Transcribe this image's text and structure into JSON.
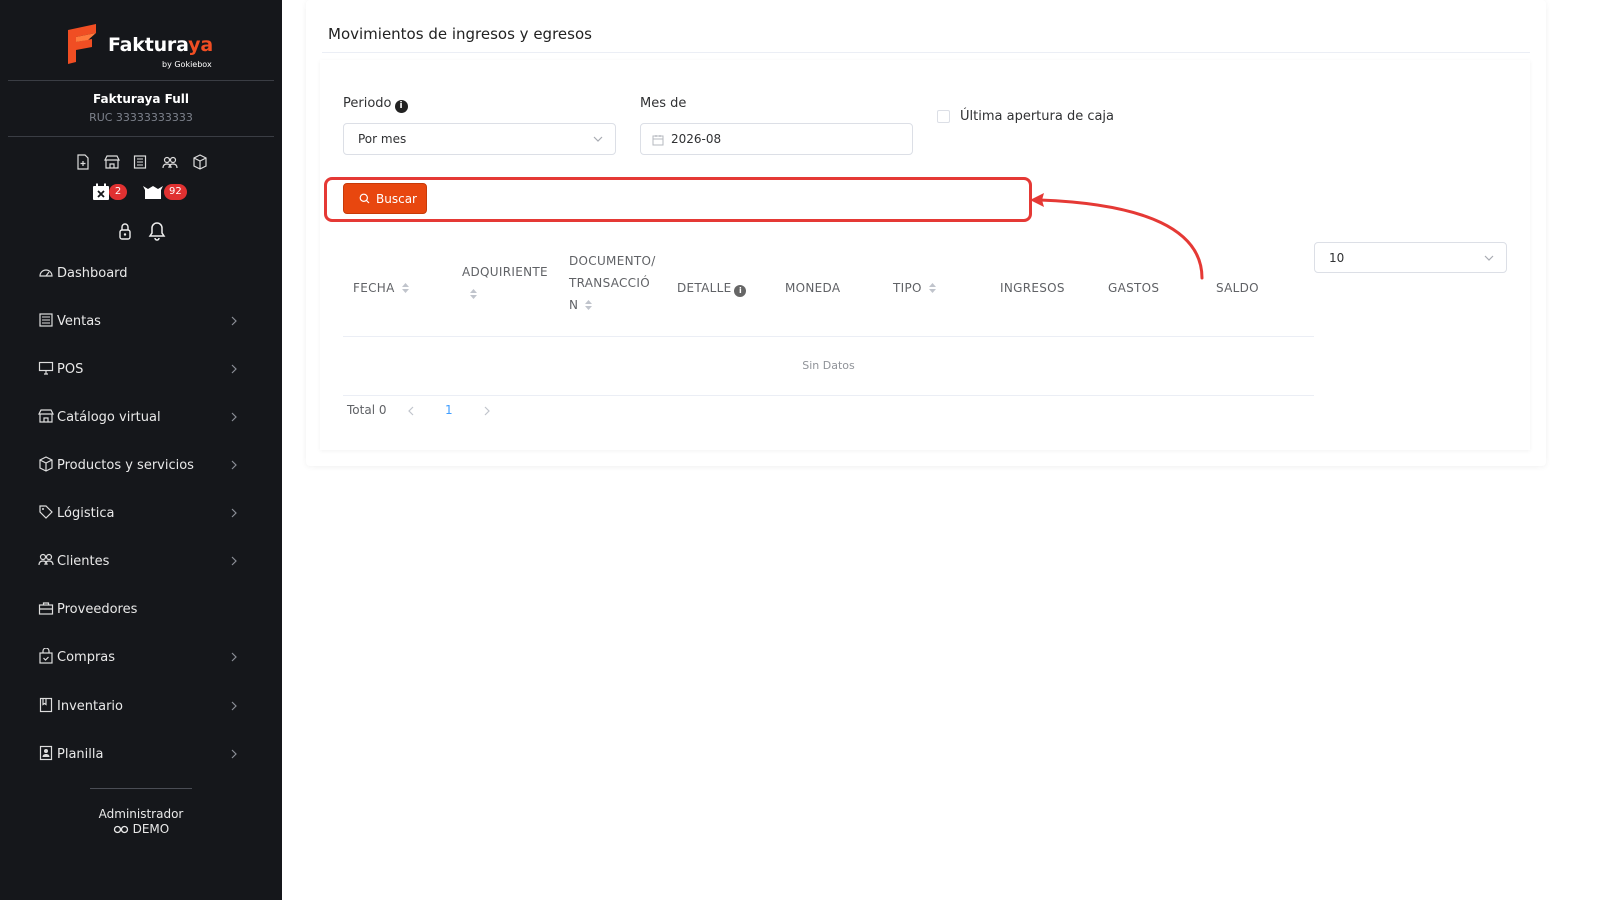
{
  "brand": {
    "name_main": "Faktura",
    "name_accent": "ya",
    "byline": "by Gokiebox",
    "accent_color": "#f04e23"
  },
  "company": {
    "name": "Fakturaya Full",
    "ruc": "RUC 33333333333"
  },
  "quick_icons": [
    "document-add-icon",
    "store-icon",
    "receipt-icon",
    "users-icon",
    "box-icon"
  ],
  "badges": {
    "calendar_count": "2",
    "box_count": "92"
  },
  "util_icons": [
    "lock-icon",
    "bell-icon"
  ],
  "sidebar": {
    "items": [
      {
        "label": "Dashboard",
        "icon": "dashboard-icon",
        "has_children": false
      },
      {
        "label": "Ventas",
        "icon": "ventas-icon",
        "has_children": true
      },
      {
        "label": "POS",
        "icon": "monitor-icon",
        "has_children": true
      },
      {
        "label": "Catálogo virtual",
        "icon": "store-icon",
        "has_children": true
      },
      {
        "label": "Productos y servicios",
        "icon": "box-icon",
        "has_children": true
      },
      {
        "label": "Lógistica",
        "icon": "tag-icon",
        "has_children": true
      },
      {
        "label": "Clientes",
        "icon": "users-icon",
        "has_children": true
      },
      {
        "label": "Proveedores",
        "icon": "briefcase-icon",
        "has_children": false
      },
      {
        "label": "Compras",
        "icon": "shopping-bag-icon",
        "has_children": true
      },
      {
        "label": "Inventario",
        "icon": "inventory-icon",
        "has_children": true
      },
      {
        "label": "Planilla",
        "icon": "payroll-icon",
        "has_children": true
      }
    ]
  },
  "user": {
    "role": "Administrador",
    "name": "DEMO"
  },
  "page": {
    "title": "Movimientos de ingresos y egresos"
  },
  "filters": {
    "periodo_label": "Periodo",
    "periodo_value": "Por mes",
    "mes_label": "Mes de",
    "mes_value": "2026-08",
    "ultima_apertura_label": "Última apertura de caja"
  },
  "search_button": "Buscar",
  "page_size": "10",
  "table": {
    "headers": {
      "fecha": "FECHA",
      "adquiriente": "ADQUIRIENTE",
      "documento_1": "DOCUMENTO/",
      "documento_2": "TRANSACCIÓ",
      "documento_3": "N",
      "detalle": "DETALLE",
      "moneda": "MONEDA",
      "tipo": "TIPO",
      "ingresos": "INGRESOS",
      "gastos": "GASTOS",
      "saldo": "SALDO"
    },
    "empty_text": "Sin Datos"
  },
  "pagination": {
    "total": "Total 0",
    "current_page": "1"
  }
}
